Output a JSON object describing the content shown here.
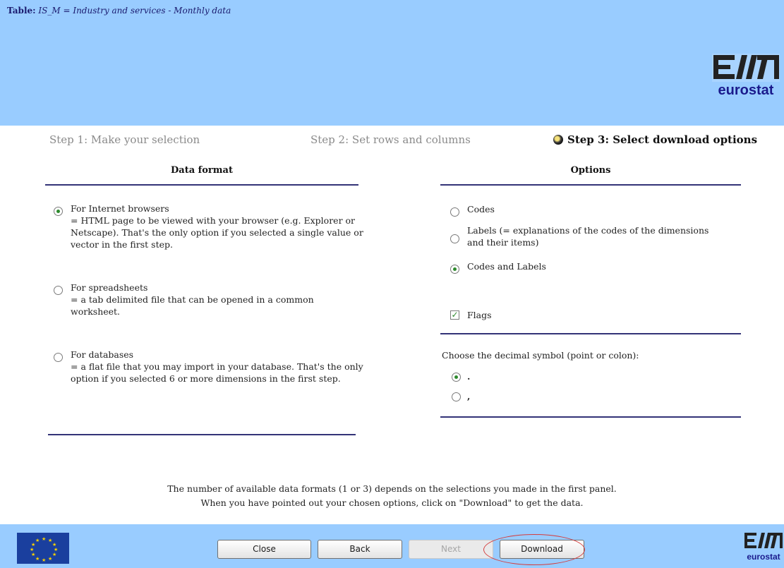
{
  "header": {
    "table_prefix": "Table:",
    "table_name": "IS_M = Industry and services - Monthly data",
    "logo_text": "eurostat"
  },
  "steps": [
    {
      "label": "Step 1: Make your selection",
      "active": false
    },
    {
      "label": "Step 2: Set rows and columns",
      "active": false
    },
    {
      "label": "Step 3: Select download options",
      "active": true
    }
  ],
  "data_format": {
    "heading": "Data format",
    "options": [
      {
        "title": "For Internet browsers",
        "description": "= HTML page to be viewed with your browser (e.g. Explorer or Netscape). That's the only option if you selected a single value or vector in the first step.",
        "checked": true
      },
      {
        "title": "For spreadsheets",
        "description": "= a tab delimited file that can be opened in a common worksheet.",
        "checked": false
      },
      {
        "title": "For databases",
        "description": "= a flat file that you may import in your database. That's the only option if you selected 6 or more dimensions in the first step.",
        "checked": false
      }
    ]
  },
  "options_panel": {
    "heading": "Options",
    "label_options": [
      {
        "label": "Codes",
        "checked": false
      },
      {
        "label": "Labels (= explanations of the codes of the dimensions and their items)",
        "checked": false
      },
      {
        "label": "Codes and Labels",
        "checked": true
      }
    ],
    "flags": {
      "label": "Flags",
      "checked": true
    },
    "decimal_prompt": "Choose the decimal symbol (point or colon):",
    "decimal_options": [
      {
        "label": ".",
        "checked": true
      },
      {
        "label": ",",
        "checked": false
      }
    ]
  },
  "notes": [
    "The number of available data formats (1 or 3) depends on the selections you made in the first panel.",
    "When you have pointed out your chosen options, click on \"Download\" to get the data."
  ],
  "footer": {
    "buttons": {
      "close": "Close",
      "back": "Back",
      "next": "Next",
      "download": "Download"
    },
    "logo_text": "eurostat"
  },
  "colors": {
    "header_bg": "#99ccff",
    "rule": "#333377",
    "highlight": "#d43c3c"
  }
}
